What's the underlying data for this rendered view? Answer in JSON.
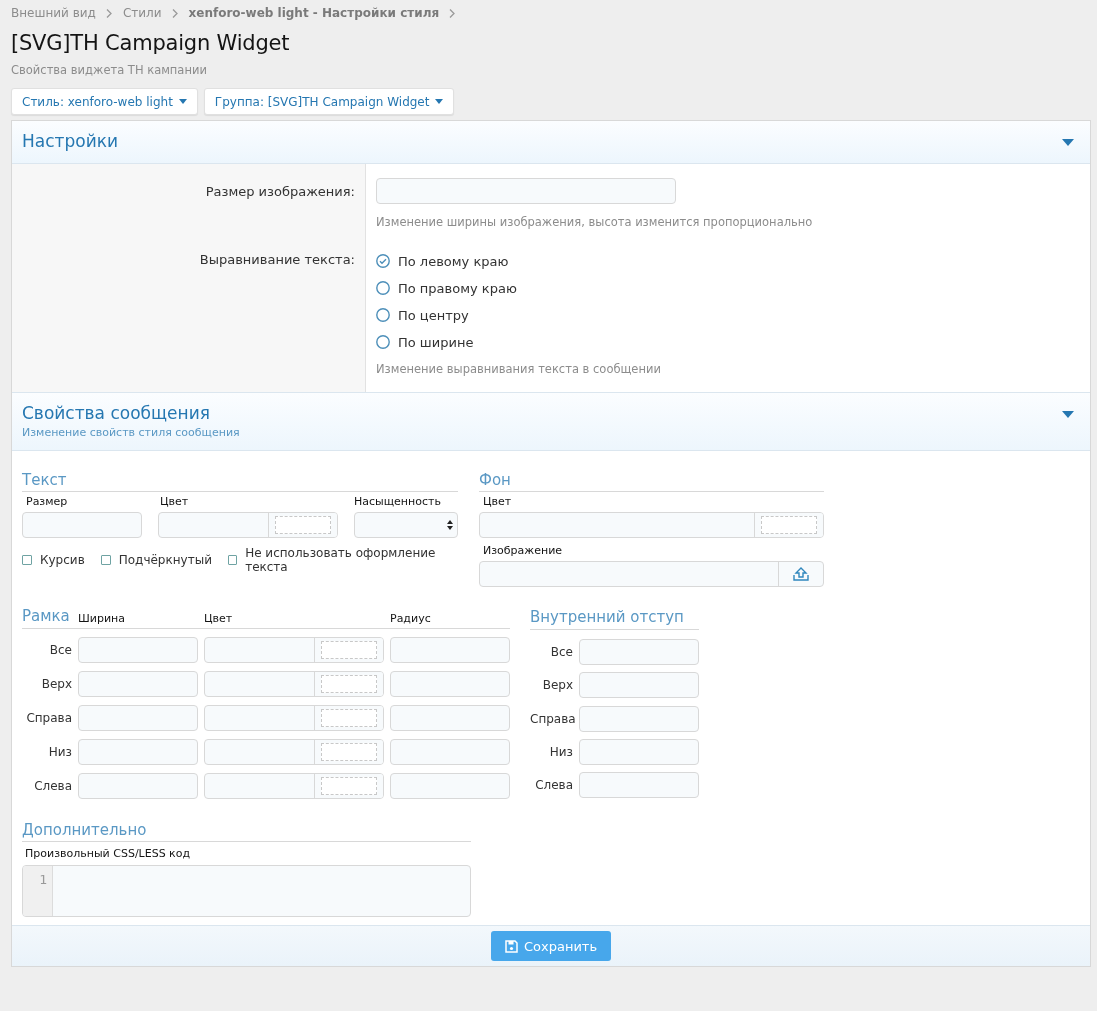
{
  "breadcrumbs": [
    {
      "label": "Внешний вид",
      "kind": "link"
    },
    {
      "label": "Стили",
      "kind": "link"
    },
    {
      "label": "xenforo-web light - Настройки стиля",
      "kind": "current"
    }
  ],
  "title": "[SVG]TH Campaign Widget",
  "description": "Свойства виджета TH кампании",
  "selectors": [
    {
      "label": "Стиль: xenforo-web light"
    },
    {
      "label": "Группа: [SVG]TH Campaign Widget"
    }
  ],
  "settings": {
    "title": "Настройки",
    "image_size": {
      "label": "Размер изображения:",
      "hint": "Изменение ширины изображения, высота изменится пропорционально"
    },
    "text_align": {
      "label": "Выравнивание текста:",
      "options": [
        {
          "label": "По левому краю",
          "selected": true
        },
        {
          "label": "По правому краю",
          "selected": false
        },
        {
          "label": "По центру",
          "selected": false
        },
        {
          "label": "По ширине",
          "selected": false
        }
      ],
      "hint": "Изменение выравнивания текста в сообщении"
    }
  },
  "message": {
    "title": "Свойства сообщения",
    "subtitle": "Изменение свойств стиля сообщения",
    "text": {
      "title": "Текст",
      "size_label": "Размер",
      "color_label": "Цвет",
      "weight_label": "Насыщенность",
      "checkboxes": [
        {
          "label": "Курсив",
          "checked": false
        },
        {
          "label": "Подчёркнутый",
          "checked": false
        },
        {
          "label": "Не использовать оформление текста",
          "checked": false
        }
      ]
    },
    "background": {
      "title": "Фон",
      "color_label": "Цвет",
      "image_label": "Изображение"
    },
    "border": {
      "title": "Рамка",
      "columns": [
        "Ширина",
        "Цвет",
        "Радиус"
      ],
      "rows": [
        "Все",
        "Верх",
        "Справа",
        "Низ",
        "Слева"
      ]
    },
    "padding": {
      "title": "Внутренний отступ",
      "rows": [
        "Все",
        "Верх",
        "Справа",
        "Низ",
        "Слева"
      ]
    },
    "extra": {
      "title": "Дополнительно",
      "code_label": "Произвольный CSS/LESS код",
      "line_number": "1"
    }
  },
  "save_button": "Сохранить"
}
